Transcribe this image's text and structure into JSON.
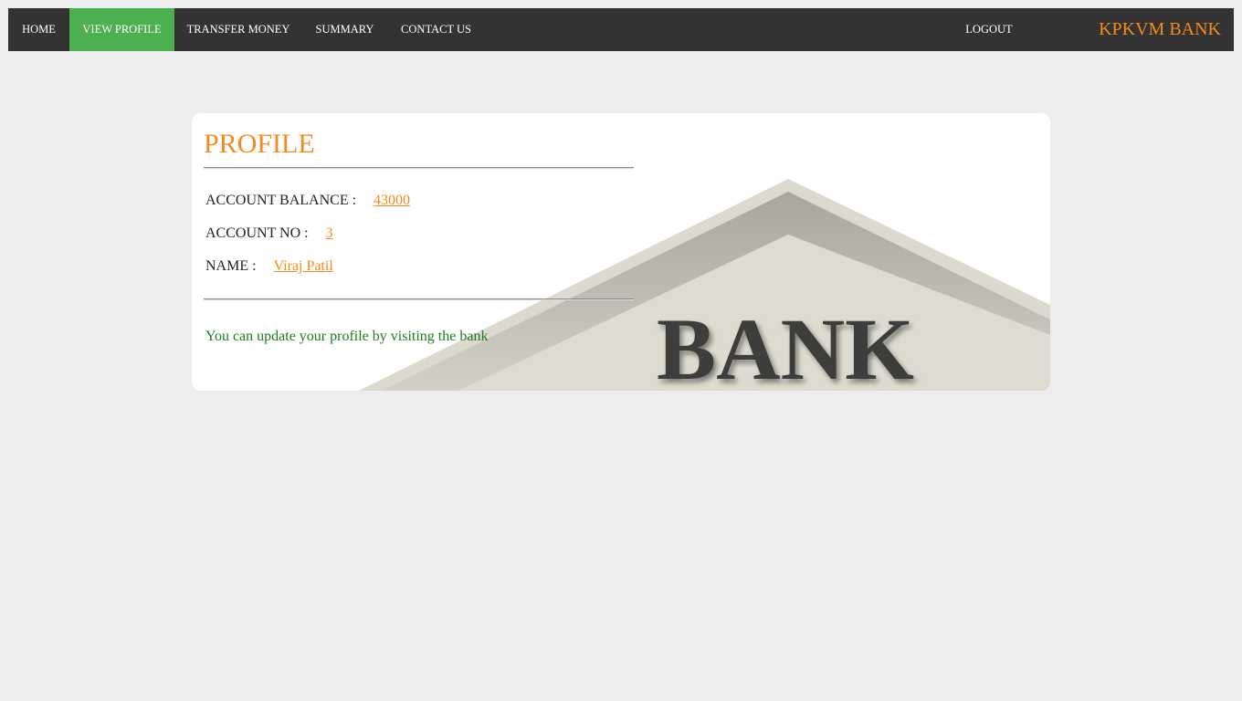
{
  "colors": {
    "nav_bg": "#333333",
    "nav_active": "#4caf50",
    "accent": "#f58a1f",
    "note_green": "#1f7a1f",
    "page_bg": "#ededed"
  },
  "nav": {
    "items": [
      {
        "label": "HOME",
        "active": false
      },
      {
        "label": "VIEW PROFILE",
        "active": true
      },
      {
        "label": "TRANSFER MONEY",
        "active": false
      },
      {
        "label": "SUMMARY",
        "active": false
      },
      {
        "label": "CONTACT US",
        "active": false
      }
    ],
    "logout_label": "LOGOUT",
    "brand": "KPKVM BANK"
  },
  "profile": {
    "title": "PROFILE",
    "balance_label": "ACCOUNT BALANCE :",
    "balance_value": "43000",
    "account_no_label": "ACCOUNT NO :",
    "account_no_value": "3",
    "name_label": "NAME :",
    "name_value": "Viraj Patil",
    "note": "You can update your profile by visiting the bank",
    "illustration_text": "BANK"
  }
}
